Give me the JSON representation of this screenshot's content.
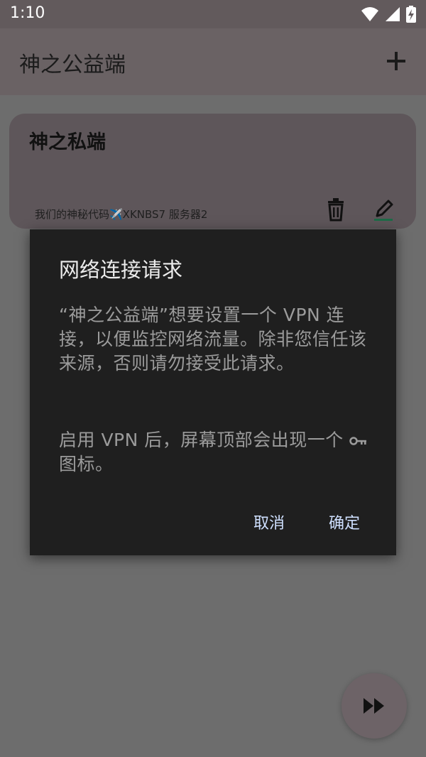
{
  "status_bar": {
    "time": "1:10",
    "icons": [
      "wifi-icon",
      "signal-icon",
      "battery-charging-icon"
    ]
  },
  "app_bar": {
    "title": "神之公益端",
    "add_icon": "plus-icon"
  },
  "server_card": {
    "name": "神之私端",
    "subtitle": "我们的神秘代码✈️XKNBS7  服务器2",
    "delete_icon": "trash-icon",
    "edit_icon": "pencil-icon"
  },
  "dialog": {
    "title": "网络连接请求",
    "message_1": "“神之公益端”想要设置一个 VPN 连接，以便监控网络流量。除非您信任该来源，否则请勿接受此请求。",
    "message_2_before_icon": "启用 VPN 后，屏幕顶部会出现一个 ",
    "message_2_after_icon": " 图标。",
    "inline_icon": "key-icon",
    "cancel_label": "取消",
    "ok_label": "确定"
  },
  "fab": {
    "icon": "fast-forward-icon"
  },
  "colors": {
    "dim_background": "#6d6d6d",
    "dialog_background": "#1f1f1f",
    "button_text": "#cfe0ff"
  }
}
